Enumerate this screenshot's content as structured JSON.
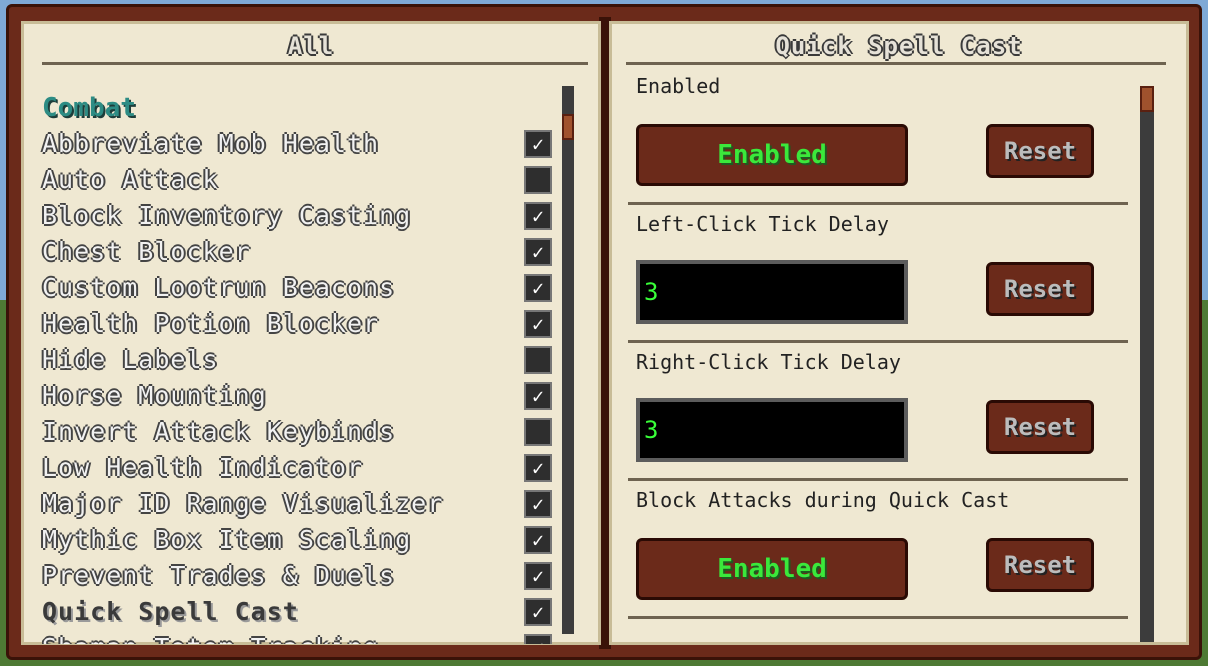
{
  "left_page": {
    "title": "All",
    "category": "Combat",
    "items": [
      {
        "label": "Abbreviate Mob Health",
        "checked": true
      },
      {
        "label": "Auto Attack",
        "checked": false
      },
      {
        "label": "Block Inventory Casting",
        "checked": true
      },
      {
        "label": "Chest Blocker",
        "checked": true
      },
      {
        "label": "Custom Lootrun Beacons",
        "checked": true
      },
      {
        "label": "Health Potion Blocker",
        "checked": true
      },
      {
        "label": "Hide Labels",
        "checked": false
      },
      {
        "label": "Horse Mounting",
        "checked": true
      },
      {
        "label": "Invert Attack Keybinds",
        "checked": false
      },
      {
        "label": "Low Health Indicator",
        "checked": true
      },
      {
        "label": "Major ID Range Visualizer",
        "checked": true
      },
      {
        "label": "Mythic Box Item Scaling",
        "checked": true
      },
      {
        "label": "Prevent Trades & Duels",
        "checked": true
      },
      {
        "label": "Quick Spell Cast",
        "checked": true
      },
      {
        "label": "Shaman Totem Tracking",
        "checked": true
      }
    ]
  },
  "right_page": {
    "title": "Quick Spell Cast",
    "settings": [
      {
        "label": "Enabled",
        "type": "toggle",
        "value": "Enabled",
        "reset": "Reset"
      },
      {
        "label": "Left-Click Tick Delay",
        "type": "number",
        "value": "3",
        "reset": "Reset"
      },
      {
        "label": "Right-Click Tick Delay",
        "type": "number",
        "value": "3",
        "reset": "Reset"
      },
      {
        "label": "Block Attacks during Quick Cast",
        "type": "toggle",
        "value": "Enabled",
        "reset": "Reset"
      }
    ]
  },
  "checkmark_glyph": "✓"
}
